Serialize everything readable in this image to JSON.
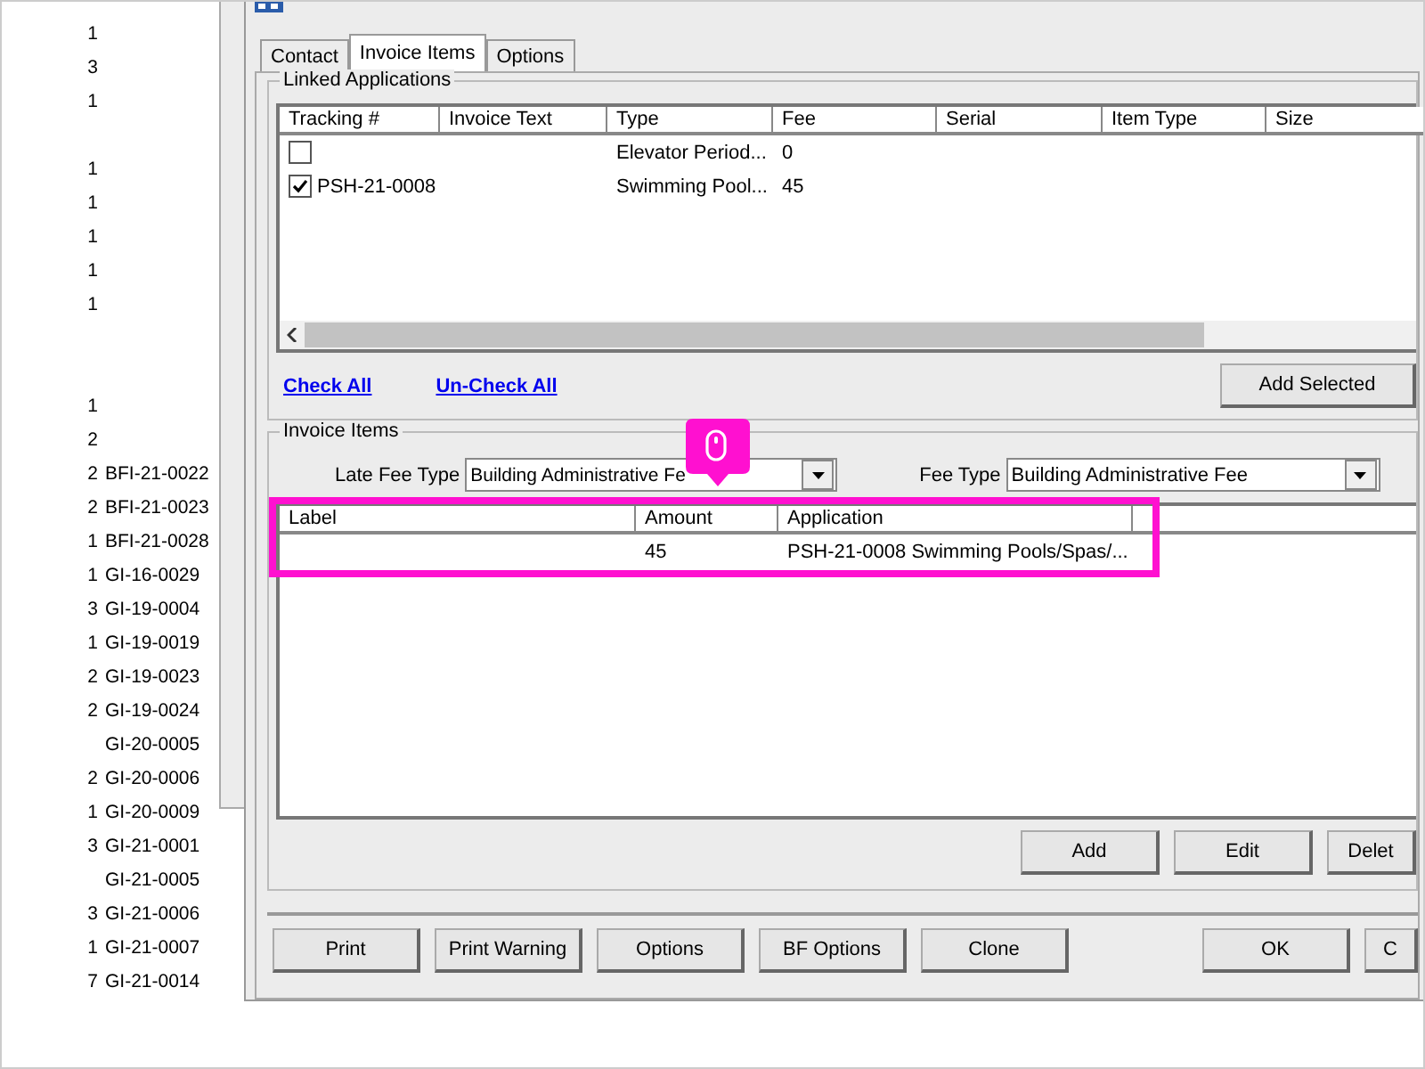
{
  "background_list": {
    "rows": [
      {
        "kind": "entry",
        "count": "1"
      },
      {
        "kind": "entry",
        "count": "3"
      },
      {
        "kind": "entry",
        "count": "1"
      },
      {
        "kind": "blank"
      },
      {
        "kind": "entry",
        "count": "1"
      },
      {
        "kind": "entry",
        "count": "1"
      },
      {
        "kind": "entry",
        "count": "1"
      },
      {
        "kind": "entry",
        "count": "1"
      },
      {
        "kind": "entry",
        "count": "1"
      },
      {
        "kind": "blank"
      },
      {
        "kind": "blank"
      },
      {
        "kind": "entry",
        "count": "1"
      },
      {
        "kind": "entry",
        "count": "2"
      },
      {
        "kind": "entry",
        "count": "2",
        "code": "BFI-21-0022"
      },
      {
        "kind": "entry",
        "count": "2",
        "code": "BFI-21-0023"
      },
      {
        "kind": "entry",
        "count": "1",
        "code": "BFI-21-0028"
      },
      {
        "kind": "entry",
        "count": "1",
        "code": "GI-16-0029"
      },
      {
        "kind": "entry",
        "count": "3",
        "code": "GI-19-0004"
      },
      {
        "kind": "entry",
        "count": "1",
        "code": "GI-19-0019"
      },
      {
        "kind": "entry",
        "count": "2",
        "code": "GI-19-0023"
      },
      {
        "kind": "entry",
        "count": "2",
        "code": "GI-19-0024"
      },
      {
        "kind": "entry",
        "code": "GI-20-0005"
      },
      {
        "kind": "entry",
        "count": "2",
        "code": "GI-20-0006"
      },
      {
        "kind": "entry",
        "count": "1",
        "code": "GI-20-0009"
      },
      {
        "kind": "entry",
        "count": "3",
        "code": "GI-21-0001"
      },
      {
        "kind": "entry",
        "code": "GI-21-0005"
      },
      {
        "kind": "entry",
        "count": "3",
        "code": "GI-21-0006"
      },
      {
        "kind": "entry",
        "count": "1",
        "code": "GI-21-0007"
      },
      {
        "kind": "entry",
        "count": "7",
        "code": "GI-21-0014"
      }
    ]
  },
  "dialog": {
    "tabs": [
      {
        "label": "Contact",
        "selected": false
      },
      {
        "label": "Invoice Items",
        "selected": true
      },
      {
        "label": "Options",
        "selected": false
      }
    ],
    "linked_applications": {
      "title": "Linked Applications",
      "columns": [
        "Tracking #",
        "Invoice Text",
        "Type",
        "Fee",
        "Serial",
        "Item Type",
        "Size"
      ],
      "rows": [
        {
          "checked": false,
          "type": "Elevator Period...",
          "fee": "0"
        },
        {
          "checked": true,
          "tracking": "PSH-21-0008",
          "type": "Swimming Pool...",
          "fee": "45"
        }
      ],
      "links": [
        "Check All",
        "Un-Check All"
      ],
      "add_button": "Add Selected"
    },
    "invoice_items": {
      "title": "Invoice Items",
      "late_fee_type": {
        "label": "Late Fee Type",
        "value": "Building Administrative Fe"
      },
      "fee_type": {
        "label": "Fee Type",
        "value": "Building Administrative Fee"
      },
      "columns": [
        "Label",
        "Amount",
        "Application"
      ],
      "rows": [
        {
          "amount": "45",
          "application": "PSH-21-0008 Swimming Pools/Spas/..."
        }
      ],
      "buttons": [
        "Add",
        "Edit",
        "Delet"
      ]
    },
    "footer_left": [
      "Print",
      "Print Warning",
      "Options",
      "BF Options",
      "Clone"
    ],
    "footer_right": [
      "OK",
      "C"
    ]
  }
}
